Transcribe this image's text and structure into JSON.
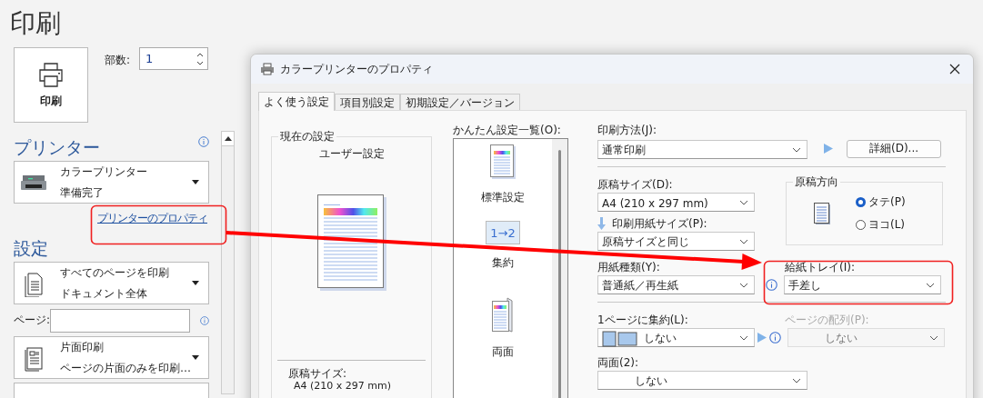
{
  "page_title": "印刷",
  "print_button": {
    "label": "印刷"
  },
  "copies": {
    "label": "部数:",
    "value": "1"
  },
  "printer_section": {
    "heading": "プリンター",
    "printer": {
      "name": "カラープリンター",
      "status": "準備完了"
    },
    "properties_link": "プリンターのプロパティ"
  },
  "settings_section": {
    "heading": "設定",
    "dropdowns": [
      {
        "kind": "pages",
        "title": "すべてのページを印刷",
        "subtitle": "ドキュメント全体"
      },
      {
        "kind": "sides",
        "title": "片面印刷",
        "subtitle": "ページの片面のみを印刷…"
      }
    ],
    "pages_field": {
      "label": "ページ:"
    }
  },
  "dialog": {
    "title": "カラープリンターのプロパティ",
    "tabs": [
      {
        "label": "よく使う設定",
        "selected": true
      },
      {
        "label": "項目別設定",
        "selected": false
      },
      {
        "label": "初期設定／バージョン",
        "selected": false
      }
    ],
    "current_settings": {
      "legend": "現在の設定",
      "preset": "ユーザー設定",
      "summary_label": "原稿サイズ:",
      "summary_value": "A4 (210 x 297 mm)"
    },
    "presets": {
      "label": "かんたん設定一覧(O):",
      "items": [
        {
          "kind": "standard",
          "label": "標準設定"
        },
        {
          "kind": "nup",
          "label": "集約",
          "icon_text": "1→2"
        },
        {
          "kind": "duplex",
          "label": "両面"
        }
      ]
    },
    "print_method": {
      "label": "印刷方法(J):",
      "value": "通常印刷"
    },
    "details_button": "詳細(D)...",
    "original_size": {
      "label": "原稿サイズ(D):",
      "value": "A4 (210 x 297 mm)"
    },
    "output_size": {
      "label": "印刷用紙サイズ(P):",
      "value": "原稿サイズと同じ"
    },
    "orientation": {
      "legend": "原稿方向",
      "options": [
        {
          "label": "タテ(P)",
          "selected": true
        },
        {
          "label": "ヨコ(L)",
          "selected": false
        }
      ]
    },
    "paper_type": {
      "label": "用紙種類(Y):",
      "value": "普通紙／再生紙"
    },
    "paper_tray": {
      "label": "給紙トレイ(I):",
      "value": "手差し"
    },
    "pages_per_sheet": {
      "label": "1ページに集約(L):",
      "value": "しない",
      "disabled": false
    },
    "page_order": {
      "label": "ページの配列(P):",
      "value": "しない",
      "disabled": true
    },
    "duplex": {
      "label": "両面(2):",
      "value": "しない",
      "disabled": false
    }
  }
}
